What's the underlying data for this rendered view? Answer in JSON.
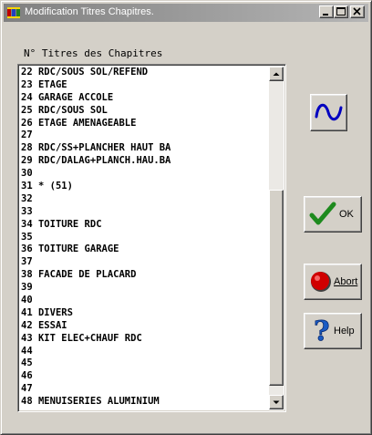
{
  "window": {
    "title": "Modification Titres Chapitres."
  },
  "list": {
    "header": "N° Titres des Chapitres",
    "items": [
      {
        "num": "22",
        "title": "RDC/SOUS SOL/REFEND"
      },
      {
        "num": "23",
        "title": "ETAGE"
      },
      {
        "num": "24",
        "title": "GARAGE ACCOLE"
      },
      {
        "num": "25",
        "title": "RDC/SOUS SOL"
      },
      {
        "num": "26",
        "title": "ETAGE AMENAGEABLE"
      },
      {
        "num": "27",
        "title": ""
      },
      {
        "num": "28",
        "title": "RDC/SS+PLANCHER HAUT BA"
      },
      {
        "num": "29",
        "title": "RDC/DALAG+PLANCH.HAU.BA"
      },
      {
        "num": "30",
        "title": ""
      },
      {
        "num": "31",
        "title": "* (51)"
      },
      {
        "num": "32",
        "title": ""
      },
      {
        "num": "33",
        "title": ""
      },
      {
        "num": "34",
        "title": "TOITURE RDC"
      },
      {
        "num": "35",
        "title": ""
      },
      {
        "num": "36",
        "title": "TOITURE GARAGE"
      },
      {
        "num": "37",
        "title": ""
      },
      {
        "num": "38",
        "title": "FACADE DE PLACARD"
      },
      {
        "num": "39",
        "title": ""
      },
      {
        "num": "40",
        "title": ""
      },
      {
        "num": "41",
        "title": "DIVERS"
      },
      {
        "num": "42",
        "title": "ESSAI"
      },
      {
        "num": "43",
        "title": "KIT ELEC+CHAUF RDC"
      },
      {
        "num": "44",
        "title": ""
      },
      {
        "num": "45",
        "title": ""
      },
      {
        "num": "46",
        "title": ""
      },
      {
        "num": "47",
        "title": ""
      },
      {
        "num": "48",
        "title": "MENUISERIES ALUMINIUM"
      }
    ]
  },
  "buttons": {
    "wave": {
      "icon": "wave-icon"
    },
    "ok": {
      "label": "OK",
      "icon": "checkmark-icon"
    },
    "abort": {
      "label": "Abort",
      "icon": "stop-icon"
    },
    "help": {
      "label": "Help",
      "icon": "question-icon"
    }
  },
  "colors": {
    "titlebar_inactive": "#808080",
    "check_green": "#1e8a1e",
    "stop_red": "#d00000",
    "wave_blue": "#0000c0",
    "help_blue": "#1a5bc4"
  }
}
